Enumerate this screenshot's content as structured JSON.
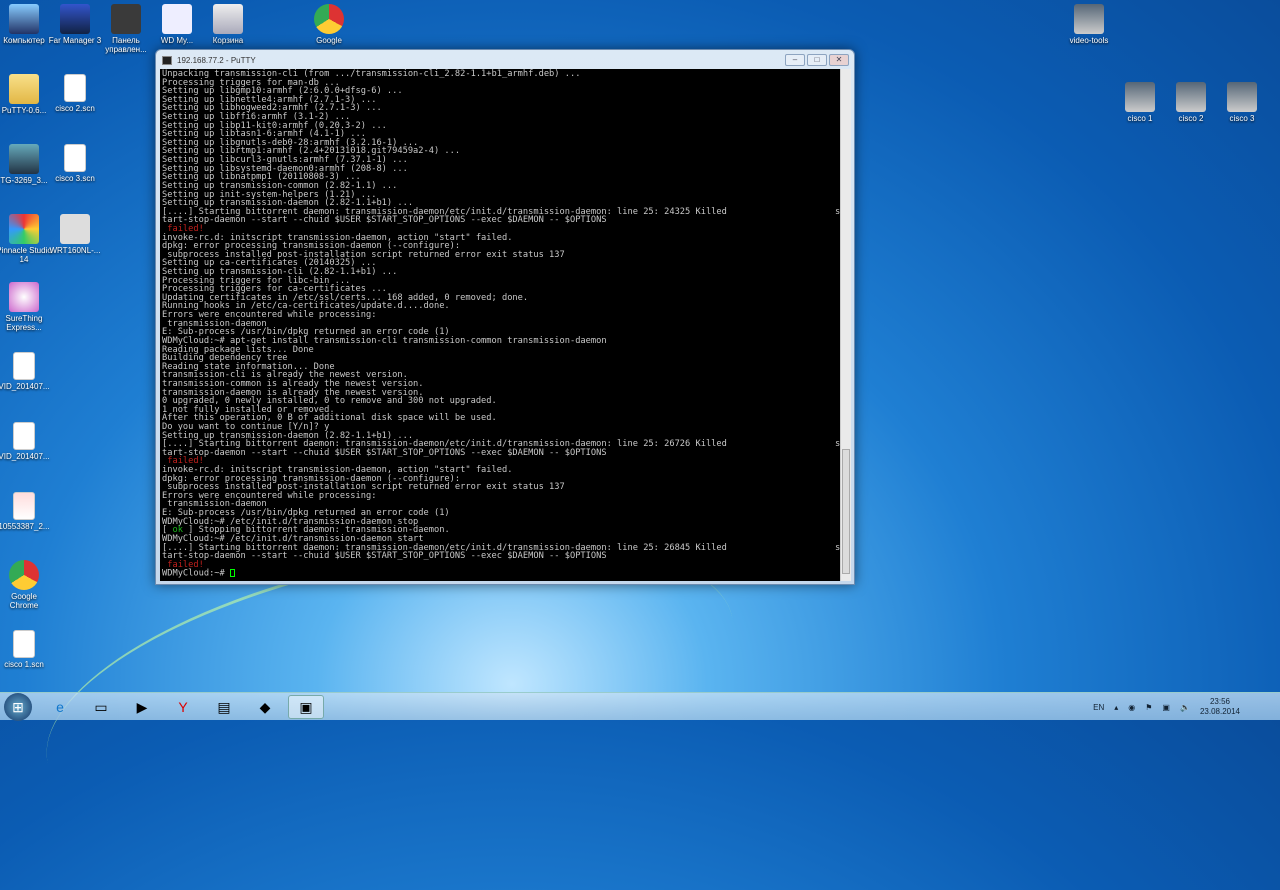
{
  "desktop_icons": [
    {
      "label": "Компьютер",
      "kind": "computer"
    },
    {
      "label": "Far Manager 3",
      "kind": "far"
    },
    {
      "label": "Панель управлен...",
      "kind": "cloud"
    },
    {
      "label": "WD My...",
      "kind": "wd"
    },
    {
      "label": "Корзина",
      "kind": "trash"
    },
    {
      "label": "Google",
      "kind": "chrome"
    },
    {
      "label": "PuTTY-0.6...",
      "kind": "folder"
    },
    {
      "label": "cisco 2.scn",
      "kind": "file"
    },
    {
      "label": "TG-3269_3...",
      "kind": "image"
    },
    {
      "label": "cisco 3.scn",
      "kind": "file"
    },
    {
      "label": "Pinnacle Studio 14",
      "kind": "pinnacle"
    },
    {
      "label": "WRT160NL-...",
      "kind": "router"
    },
    {
      "label": "SureThing Express...",
      "kind": "surething"
    },
    {
      "label": "VID_201407...",
      "kind": "file"
    },
    {
      "label": "VID_201407...",
      "kind": "file"
    },
    {
      "label": "10553387_2...",
      "kind": "doc"
    },
    {
      "label": "Google Chrome",
      "kind": "chrome"
    },
    {
      "label": "cisco 1.scn",
      "kind": "file"
    },
    {
      "label": "video-tools",
      "kind": "video"
    },
    {
      "label": "cisco 1",
      "kind": "video"
    },
    {
      "label": "cisco 2",
      "kind": "video"
    },
    {
      "label": "cisco 3",
      "kind": "video"
    }
  ],
  "window": {
    "title": "192.168.77.2 - PuTTY",
    "minimize": "–",
    "maximize": "□",
    "close": "✕"
  },
  "terminal": {
    "colors": {
      "failed": "#c0201c",
      "ok": "#19b819",
      "normal": "#c8c8c8"
    },
    "lines": [
      {
        "t": "Unpacking transmission-cli (from .../transmission-cli_2.82-1.1+b1_armhf.deb) ..."
      },
      {
        "t": "Processing triggers for man-db ..."
      },
      {
        "t": "Setting up libgmp10:armhf (2:6.0.0+dfsg-6) ..."
      },
      {
        "t": "Setting up libnettle4:armhf (2.7.1-3) ..."
      },
      {
        "t": "Setting up libhogweed2:armhf (2.7.1-3) ..."
      },
      {
        "t": "Setting up libffi6:armhf (3.1-2) ..."
      },
      {
        "t": "Setting up libp11-kit0:armhf (0.20.3-2) ..."
      },
      {
        "t": "Setting up libtasn1-6:armhf (4.1-1) ..."
      },
      {
        "t": "Setting up libgnutls-deb0-28:armhf (3.2.16-1) ..."
      },
      {
        "t": "Setting up librtmp1:armhf (2.4+20131018.git79459a2-4) ..."
      },
      {
        "t": "Setting up libcurl3-gnutls:armhf (7.37.1-1) ..."
      },
      {
        "t": "Setting up libsystemd-daemon0:armhf (208-8) ..."
      },
      {
        "t": "Setting up libnatpmp1 (20110808-3) ..."
      },
      {
        "t": "Setting up transmission-common (2.82-1.1) ..."
      },
      {
        "t": "Setting up init-system-helpers (1.21) ..."
      },
      {
        "t": "Setting up transmission-daemon (2.82-1.1+b1) ..."
      },
      {
        "t": "[....] Starting bittorrent daemon: transmission-daemon/etc/init.d/transmission-daemon: line 25: 24325 Killed",
        "tail": "s"
      },
      {
        "t": "tart-stop-daemon --start --chuid $USER $START_STOP_OPTIONS --exec $DAEMON -- $OPTIONS"
      },
      {
        "t": " failed!",
        "c": "failed"
      },
      {
        "t": "invoke-rc.d: initscript transmission-daemon, action \"start\" failed."
      },
      {
        "t": "dpkg: error processing transmission-daemon (--configure):"
      },
      {
        "t": " subprocess installed post-installation script returned error exit status 137"
      },
      {
        "t": "Setting up ca-certificates (20140325) ..."
      },
      {
        "t": "Setting up transmission-cli (2.82-1.1+b1) ..."
      },
      {
        "t": "Processing triggers for libc-bin ..."
      },
      {
        "t": "Processing triggers for ca-certificates ..."
      },
      {
        "t": "Updating certificates in /etc/ssl/certs... 168 added, 0 removed; done."
      },
      {
        "t": "Running hooks in /etc/ca-certificates/update.d....done."
      },
      {
        "t": "Errors were encountered while processing:"
      },
      {
        "t": " transmission-daemon"
      },
      {
        "t": "E: Sub-process /usr/bin/dpkg returned an error code (1)"
      },
      {
        "t": "WDMyCloud:~# apt-get install transmission-cli transmission-common transmission-daemon"
      },
      {
        "t": "Reading package lists... Done"
      },
      {
        "t": "Building dependency tree"
      },
      {
        "t": "Reading state information... Done"
      },
      {
        "t": "transmission-cli is already the newest version."
      },
      {
        "t": "transmission-common is already the newest version."
      },
      {
        "t": "transmission-daemon is already the newest version."
      },
      {
        "t": "0 upgraded, 0 newly installed, 0 to remove and 300 not upgraded."
      },
      {
        "t": "1 not fully installed or removed."
      },
      {
        "t": "After this operation, 0 B of additional disk space will be used."
      },
      {
        "t": "Do you want to continue [Y/n]? y"
      },
      {
        "t": "Setting up transmission-daemon (2.82-1.1+b1) ..."
      },
      {
        "t": "[....] Starting bittorrent daemon: transmission-daemon/etc/init.d/transmission-daemon: line 25: 26726 Killed",
        "tail": "s"
      },
      {
        "t": "tart-stop-daemon --start --chuid $USER $START_STOP_OPTIONS --exec $DAEMON -- $OPTIONS"
      },
      {
        "t": " failed!",
        "c": "failed"
      },
      {
        "t": "invoke-rc.d: initscript transmission-daemon, action \"start\" failed."
      },
      {
        "t": "dpkg: error processing transmission-daemon (--configure):"
      },
      {
        "t": " subprocess installed post-installation script returned error exit status 137"
      },
      {
        "t": "Errors were encountered while processing:"
      },
      {
        "t": " transmission-daemon"
      },
      {
        "t": "E: Sub-process /usr/bin/dpkg returned an error code (1)"
      },
      {
        "t": "WDMyCloud:~# /etc/init.d/transmission-daemon stop"
      },
      {
        "t": "[ ok ] Stopping bittorrent daemon: transmission-daemon.",
        "ok": " ok "
      },
      {
        "t": "WDMyCloud:~# /etc/init.d/transmission-daemon start"
      },
      {
        "t": "[....] Starting bittorrent daemon: transmission-daemon/etc/init.d/transmission-daemon: line 25: 26845 Killed",
        "tail": "s"
      },
      {
        "t": "tart-stop-daemon --start --chuid $USER $START_STOP_OPTIONS --exec $DAEMON -- $OPTIONS"
      },
      {
        "t": " failed!",
        "c": "failed"
      },
      {
        "t": "WDMyCloud:~# ",
        "cursor": true
      }
    ]
  },
  "taskbar": {
    "apps": [
      {
        "name": "internet-explorer",
        "glyph": "e"
      },
      {
        "name": "explorer",
        "glyph": "▭"
      },
      {
        "name": "media-player",
        "glyph": "▶"
      },
      {
        "name": "yandex-browser",
        "glyph": "Y"
      },
      {
        "name": "document",
        "glyph": "▤"
      },
      {
        "name": "app",
        "glyph": "◆"
      },
      {
        "name": "putty",
        "glyph": "▣"
      }
    ],
    "language": "EN",
    "time": "23:56",
    "date": "23.08.2014"
  }
}
